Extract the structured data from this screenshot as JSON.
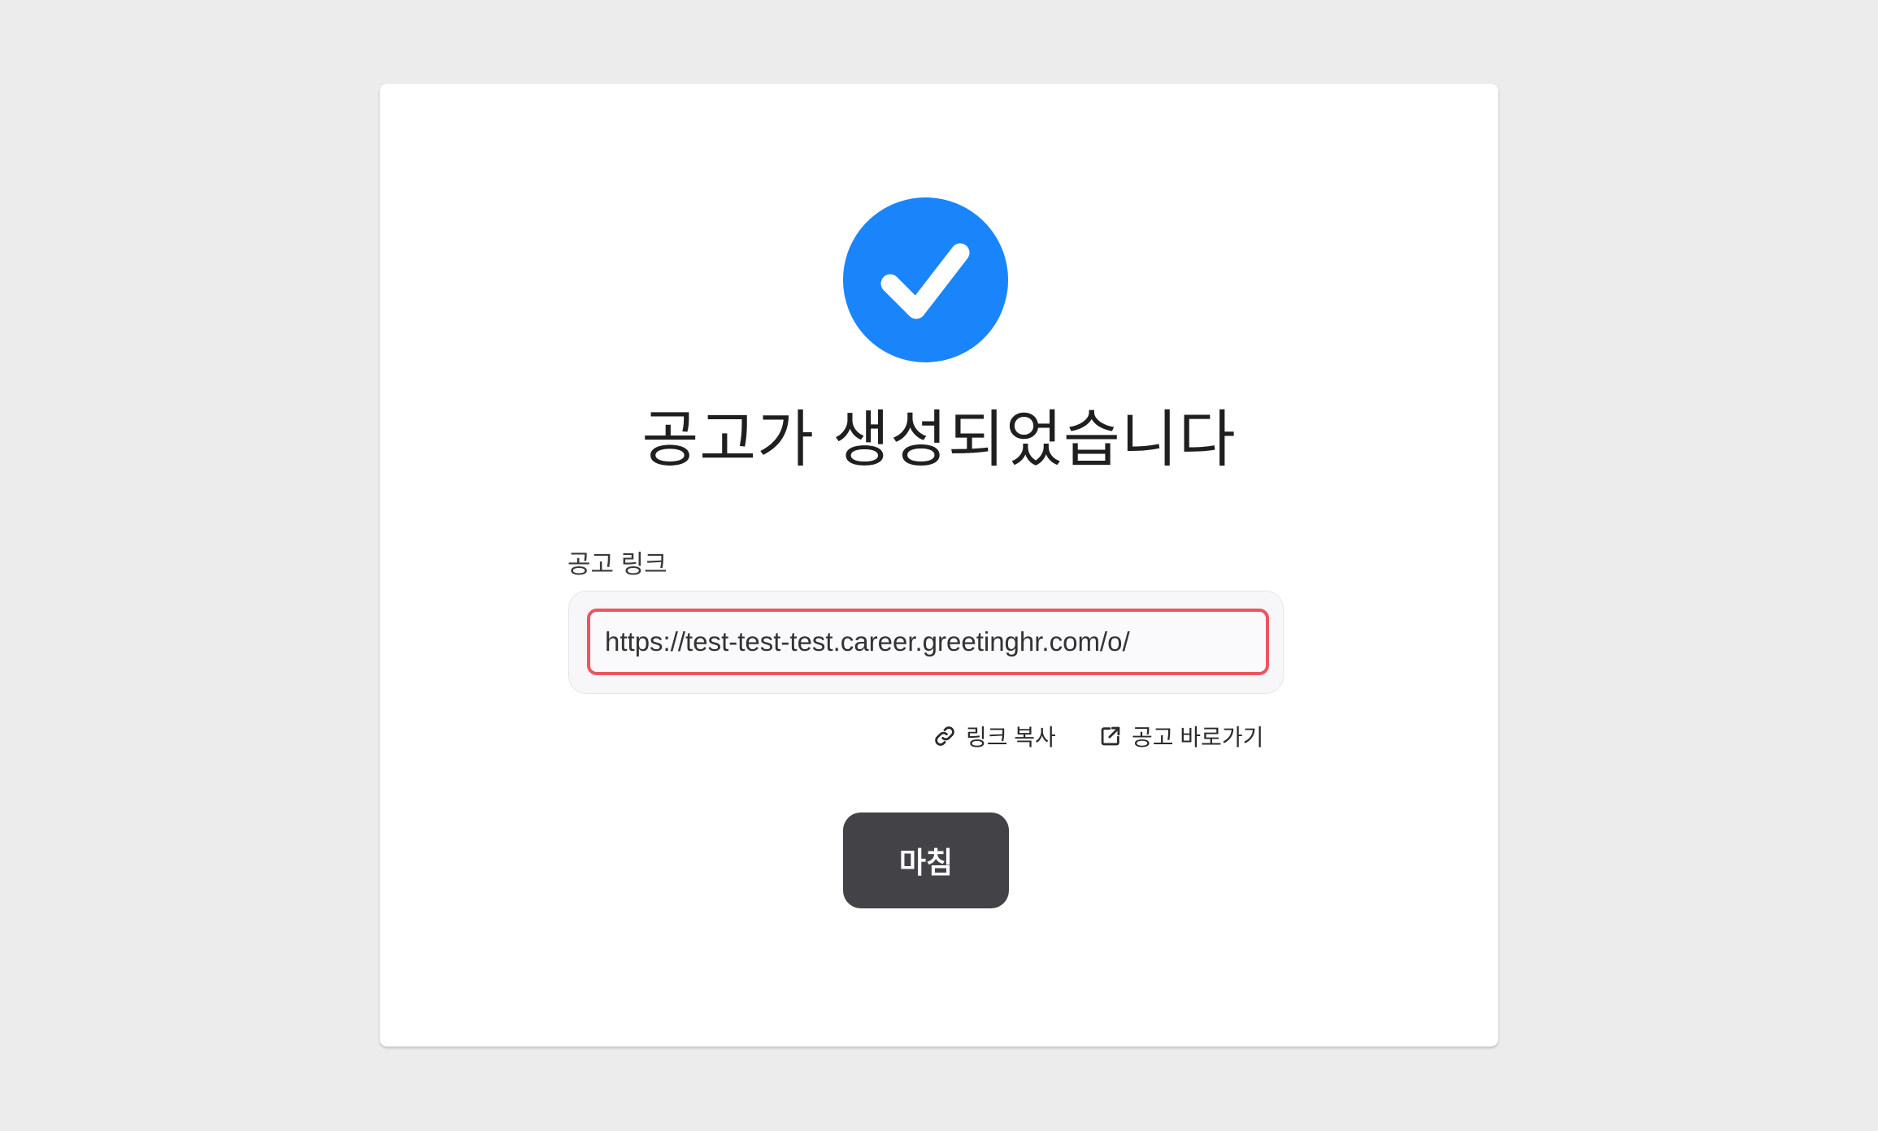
{
  "modal": {
    "title": "공고가 생성되었습니다",
    "field_label": "공고 링크",
    "link_url": "https://test-test-test.career.greetinghr.com/o/",
    "copy_link_label": "링크 복사",
    "open_posting_label": "공고 바로가기",
    "finish_label": "마침"
  },
  "icons": {
    "success": "check-circle-icon",
    "copy": "link-icon",
    "open": "external-link-icon"
  },
  "colors": {
    "accent": "#1a85fb",
    "highlight_border": "#ee5560",
    "primary_button": "#434347",
    "background": "#ececec"
  }
}
